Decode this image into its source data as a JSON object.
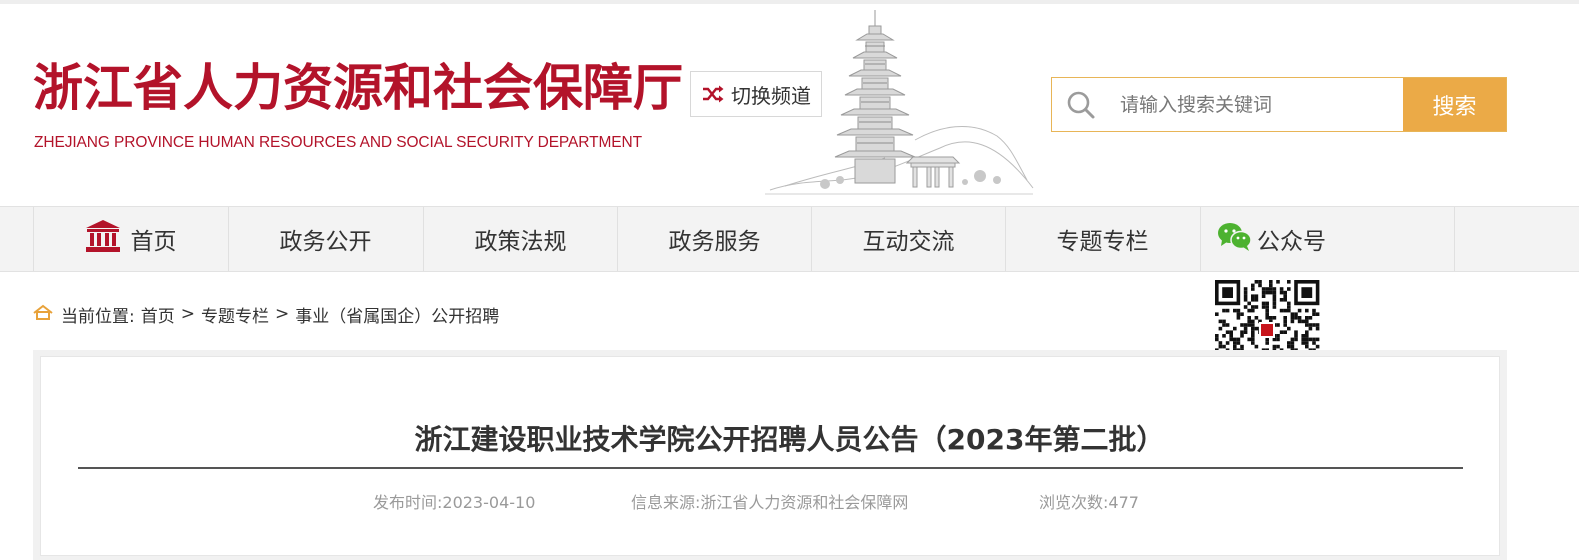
{
  "header": {
    "title_cn": "浙江省人力资源和社会保障厅",
    "title_en": "ZHEJIANG PROVINCE HUMAN RESOURCES AND SOCIAL SECURITY DEPARTMENT",
    "switch_channel_label": "切换频道",
    "brand_color": "#b3132a"
  },
  "search": {
    "placeholder": "请输入搜索关键词",
    "button_label": "搜索",
    "accent_color": "#ebaa47"
  },
  "nav": {
    "items": [
      {
        "label": "首页",
        "icon": "building-icon"
      },
      {
        "label": "政务公开"
      },
      {
        "label": "政策法规"
      },
      {
        "label": "政务服务"
      },
      {
        "label": "互动交流"
      },
      {
        "label": "专题专栏"
      },
      {
        "label": "公众号",
        "icon": "wechat-icon"
      }
    ]
  },
  "breadcrumb": {
    "prefix": "当前位置:",
    "items": [
      "首页",
      "专题专栏",
      "事业（省属国企）公开招聘"
    ],
    "separator": ">"
  },
  "article": {
    "title": "浙江建设职业技术学院公开招聘人员公告（2023年第二批）",
    "publish_time": "发布时间:2023-04-10",
    "source": "信息来源:浙江省人力资源和社会保障网",
    "views": "浏览次数:477"
  }
}
